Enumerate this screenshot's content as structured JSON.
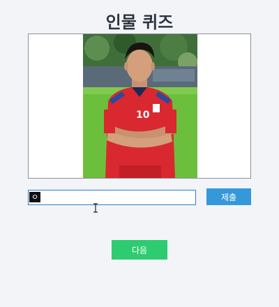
{
  "page": {
    "title": "인물 퀴즈"
  },
  "quiz": {
    "image_alt": "soccer-player-photo",
    "answer_value": "ㅇ",
    "submit_label": "제출",
    "next_label": "다음"
  },
  "colors": {
    "submit": "#3498db",
    "next": "#2ecc71",
    "jersey": "#d9282f",
    "grass": "#6cbf3c"
  }
}
